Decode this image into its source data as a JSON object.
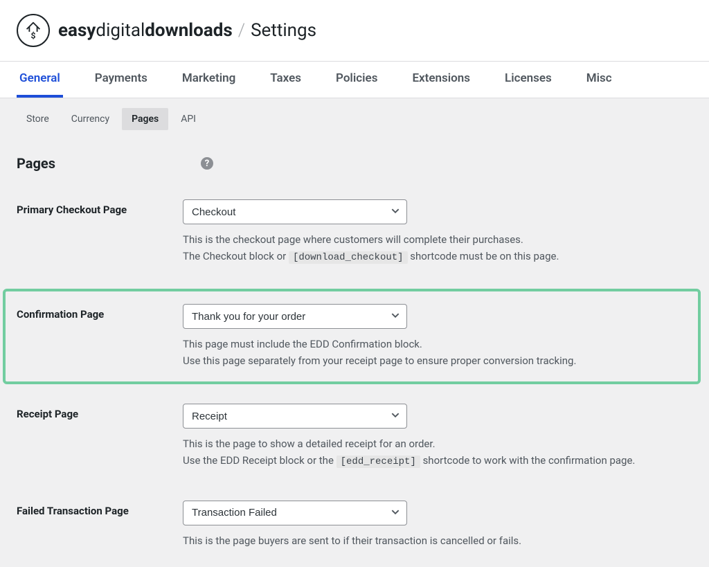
{
  "header": {
    "brand_easy": "easy",
    "brand_digital": "digital",
    "brand_downloads": "downloads",
    "title": "Settings"
  },
  "tabs": [
    {
      "label": "General",
      "active": true
    },
    {
      "label": "Payments"
    },
    {
      "label": "Marketing"
    },
    {
      "label": "Taxes"
    },
    {
      "label": "Policies"
    },
    {
      "label": "Extensions"
    },
    {
      "label": "Licenses"
    },
    {
      "label": "Misc"
    }
  ],
  "subtabs": [
    {
      "label": "Store"
    },
    {
      "label": "Currency"
    },
    {
      "label": "Pages",
      "active": true
    },
    {
      "label": "API"
    }
  ],
  "section": {
    "title": "Pages",
    "help": "?"
  },
  "fields": {
    "primary_checkout": {
      "label": "Primary Checkout Page",
      "value": "Checkout",
      "desc1": "This is the checkout page where customers will complete their purchases.",
      "desc2a": "The Checkout block or ",
      "shortcode": "[download_checkout]",
      "desc2b": " shortcode must be on this page."
    },
    "confirmation": {
      "label": "Confirmation Page",
      "value": "Thank you for your order",
      "desc1": "This page must include the EDD Confirmation block.",
      "desc2": "Use this page separately from your receipt page to ensure proper conversion tracking."
    },
    "receipt": {
      "label": "Receipt Page",
      "value": "Receipt",
      "desc1": "This is the page to show a detailed receipt for an order.",
      "desc2a": "Use the EDD Receipt block or the ",
      "shortcode": "[edd_receipt]",
      "desc2b": " shortcode to work with the confirmation page."
    },
    "failed": {
      "label": "Failed Transaction Page",
      "value": "Transaction Failed",
      "desc1": "This is the page buyers are sent to if their transaction is cancelled or fails."
    }
  }
}
